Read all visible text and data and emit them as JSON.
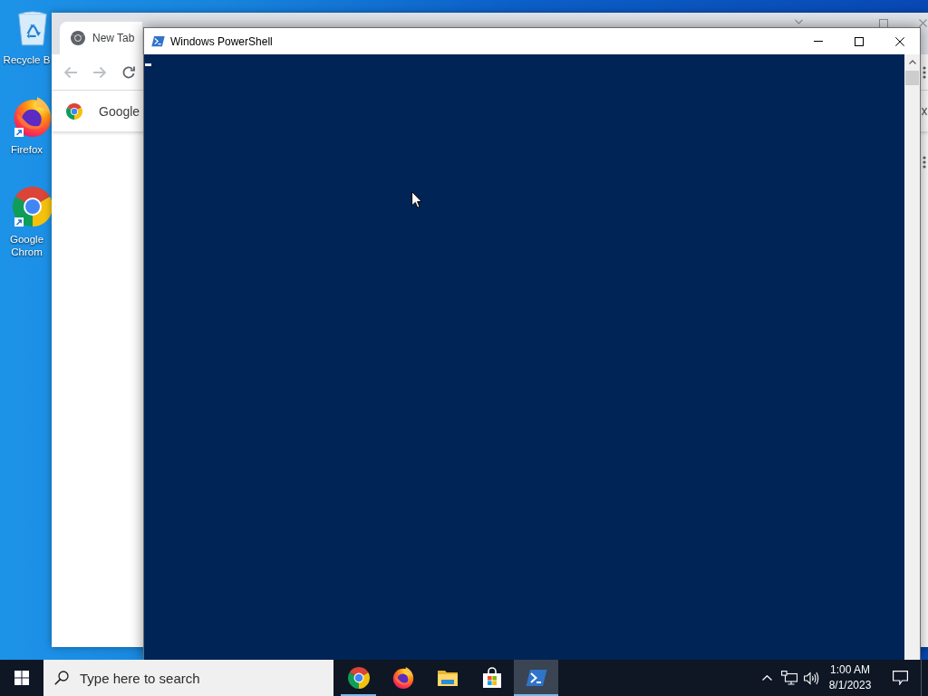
{
  "desktop": {
    "icons": [
      {
        "label": "Recycle B",
        "kind": "recycle_bin",
        "shortcut": false
      },
      {
        "label": "Firefox",
        "kind": "firefox",
        "shortcut": true
      },
      {
        "label": "Google Chrom",
        "kind": "chrome",
        "shortcut": true
      }
    ]
  },
  "browser_window": {
    "tabs": [
      {
        "title": "New Tab",
        "selected": true
      }
    ],
    "nav_buttons": [
      {
        "kind": "back",
        "disabled": true
      },
      {
        "kind": "forward",
        "disabled": true
      },
      {
        "kind": "reload",
        "disabled": false
      }
    ],
    "infobar": {
      "message": "Google"
    }
  },
  "powershell_window": {
    "title": "Windows PowerShell",
    "console": {
      "cursor": true
    }
  },
  "taskbar": {
    "search": {
      "placeholder": "Type here to search"
    },
    "apps": [
      {
        "kind": "chrome",
        "running": true,
        "selected": false
      },
      {
        "kind": "firefox",
        "running": false,
        "selected": false
      },
      {
        "kind": "explorer",
        "running": false,
        "selected": false
      },
      {
        "kind": "store",
        "running": false,
        "selected": false
      },
      {
        "kind": "powershell",
        "running": true,
        "selected": true
      }
    ],
    "clock": {
      "time": "1:00 AM",
      "date": "8/1/2023"
    }
  }
}
